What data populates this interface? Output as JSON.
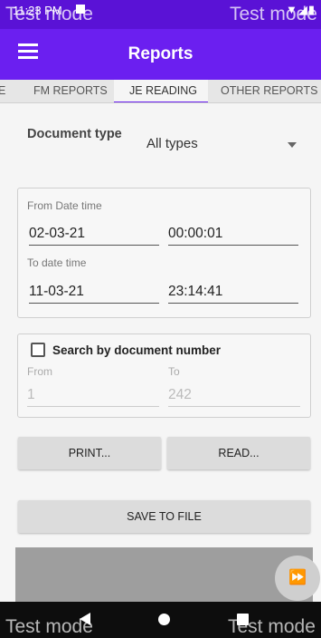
{
  "status": {
    "time": "11:23 PM",
    "icons": "▼◢▮"
  },
  "watermark": {
    "text": "Test mode"
  },
  "appbar": {
    "title": "Reports"
  },
  "tabs": [
    {
      "label": "E"
    },
    {
      "label": "FM REPORTS"
    },
    {
      "label": "JE READING"
    },
    {
      "label": "OTHER REPORTS"
    }
  ],
  "document": {
    "label": "Document type",
    "value": "All types"
  },
  "date_card": {
    "from_label": "From Date time",
    "from_date": "02-03-21",
    "from_time": "00:00:01",
    "to_label": "To date time",
    "to_date": "11-03-21",
    "to_time": "23:14:41"
  },
  "search_card": {
    "checkbox_label": "Search by document number",
    "from_label": "From",
    "from_value": "1",
    "to_label": "To",
    "to_value": "242"
  },
  "buttons": {
    "print": "PRINT...",
    "read": "READ...",
    "save": "SAVE TO FILE"
  },
  "fab": {
    "icon": "⏩"
  },
  "colors": {
    "primary": "#6b1ff0",
    "status": "#5a12d6"
  }
}
